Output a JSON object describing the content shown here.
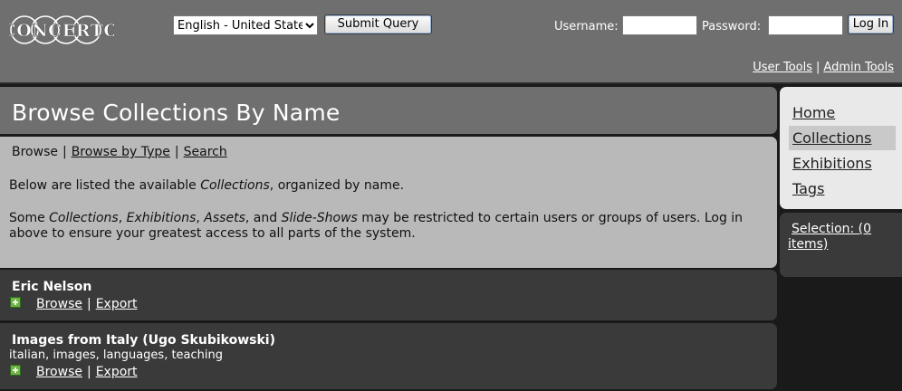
{
  "header": {
    "logo_text": "Concerto",
    "language": {
      "selected": "English - United States"
    },
    "submit_label": "Submit Query",
    "username_label": "Username:",
    "password_label": "Password:",
    "login_label": "Log In",
    "tool_links": [
      "User Tools",
      "Admin Tools"
    ],
    "tool_sep": "|"
  },
  "main": {
    "title": "Browse Collections By Name",
    "browse_nav": {
      "current": "Browse",
      "links": [
        "Browse by Type",
        "Search"
      ],
      "sep": "|"
    },
    "para1": {
      "before": "Below are listed the available ",
      "em": "Collections",
      "after": ", organized by name."
    },
    "para2": {
      "t1": "Some ",
      "e1": "Collections",
      "t2": ", ",
      "e2": "Exhibitions",
      "t3": ", ",
      "e3": "Assets",
      "t4": ", and ",
      "e4": "Slide-Shows",
      "t5": " may be restricted to certain users or groups of users. Log in above to ensure your greatest access to all parts of the system."
    },
    "collections": [
      {
        "name": "Eric Nelson",
        "tags": "",
        "browse": "Browse",
        "export": "Export",
        "sep": "|"
      },
      {
        "name": "Images from Italy (Ugo Skubikowski)",
        "tags": "italian, images, languages, teaching",
        "browse": "Browse",
        "export": "Export",
        "sep": "|"
      }
    ]
  },
  "sidebar": {
    "items": [
      {
        "label": "Home",
        "active": false
      },
      {
        "label": "Collections",
        "active": true
      },
      {
        "label": "Exhibitions",
        "active": false
      },
      {
        "label": "Tags",
        "active": false
      }
    ],
    "selection": "Selection: (0 items)"
  },
  "colors": {
    "header_bg": "#6f6f6f",
    "info_bg": "#b9b9b9",
    "collection_bg": "#3a3a3a",
    "sidebar_bg": "#e9e9e9",
    "active_item_bg": "#c9c9c9",
    "page_bg": "#1a1a1a"
  }
}
